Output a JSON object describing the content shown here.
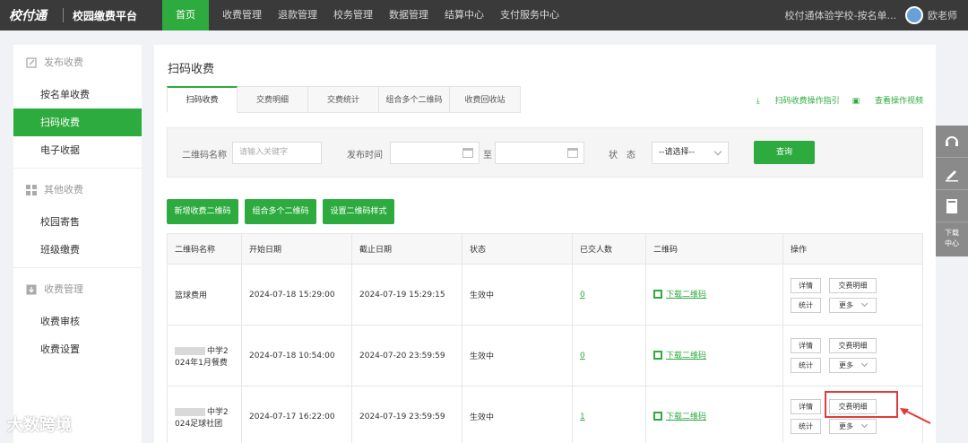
{
  "topbar": {
    "logo": "校付通",
    "platform": "校园缴费平台",
    "nav": [
      "首页",
      "收费管理",
      "退款管理",
      "校务管理",
      "数据管理",
      "结算中心",
      "支付服务中心"
    ],
    "school": "校付通体验学校-按名单...",
    "user": "欧老师"
  },
  "sidebar": {
    "group1": "发布收费",
    "items1": [
      "按名单收费",
      "扫码收费",
      "电子收据"
    ],
    "group2": "其他收费",
    "items2": [
      "校园寄售",
      "班级缴费"
    ],
    "group3": "收费管理",
    "items3": [
      "收费审核",
      "收费设置"
    ]
  },
  "main": {
    "title": "扫码收费",
    "tabs": [
      "扫码收费",
      "交费明细",
      "交费统计",
      "组合多个二维码",
      "收费回收站"
    ],
    "help": [
      "扫码收费操作指引",
      "查看操作视频"
    ],
    "filter": {
      "name_label": "二维码名称",
      "name_placeholder": "请输入关键字",
      "time_label": "发布时间",
      "to": "至",
      "status_label": "状　态",
      "status_value": "--请选择--",
      "query": "查询"
    },
    "actions": [
      "新增收费二维码",
      "组合多个二维码",
      "设置二维码样式"
    ],
    "columns": [
      "二维码名称",
      "开始日期",
      "截止日期",
      "状态",
      "已交人数",
      "二维码",
      "操作"
    ],
    "rows": [
      {
        "name1": "篮球费用",
        "name2": "",
        "start": "2024-07-18 15:29:00",
        "end": "2024-07-19 15:29:15",
        "status": "生效中",
        "count": "0",
        "qr": "下载二维码"
      },
      {
        "name1": "中学2",
        "name2": "024年1月餐费",
        "start": "2024-07-18 10:54:00",
        "end": "2024-07-20 23:59:59",
        "status": "生效中",
        "count": "0",
        "qr": "下载二维码"
      },
      {
        "name1": "中学2",
        "name2": "024足球社团",
        "start": "2024-07-17 16:22:00",
        "end": "2024-07-19 23:59:59",
        "status": "生效中",
        "count": "1",
        "qr": "下载二维码"
      }
    ],
    "ops": {
      "detail": "详情",
      "paylist": "交费明细",
      "stats": "统计",
      "more": "更多"
    }
  },
  "float_panel": {
    "download": "下载中心"
  },
  "watermark": "大数跨境",
  "colors": {
    "accent": "#2eab3f",
    "topbar": "#3a3a3a",
    "highlight": "#e13a3a"
  }
}
